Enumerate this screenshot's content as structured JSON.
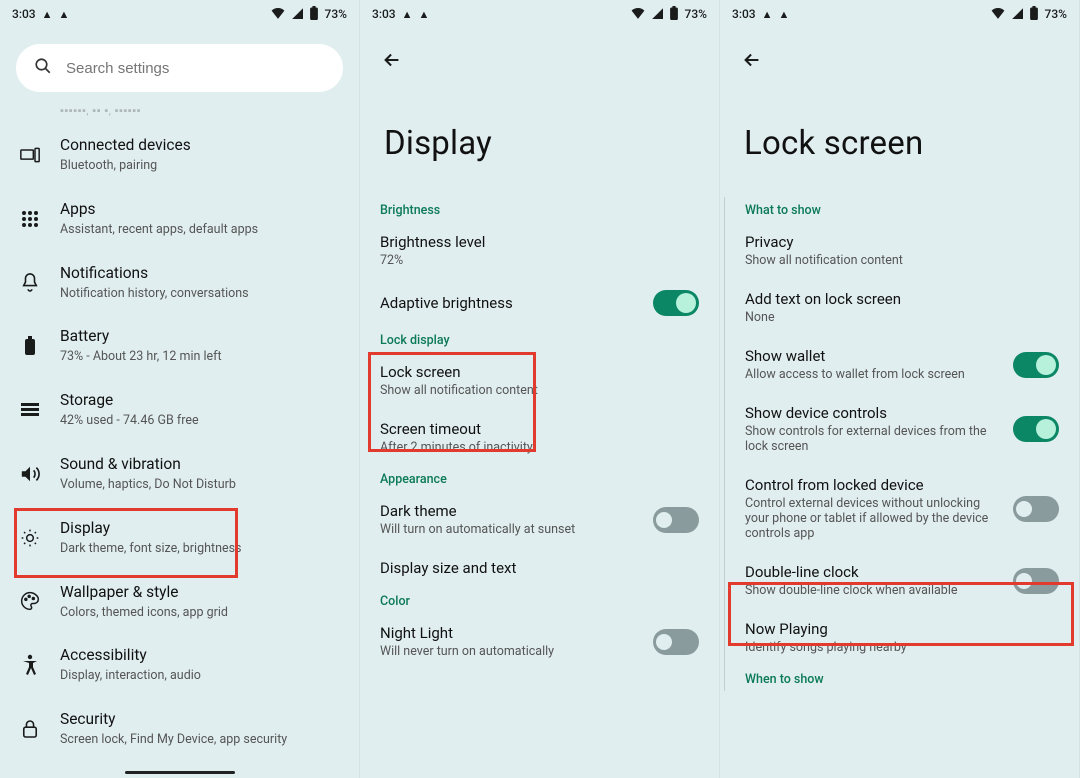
{
  "status": {
    "time": "3:03",
    "battery": "73%"
  },
  "panel1": {
    "search_placeholder": "Search settings",
    "truncated_sub": "Mobile, Wi-Fi, hotspot",
    "items": [
      {
        "title": "Connected devices",
        "sub": "Bluetooth, pairing"
      },
      {
        "title": "Apps",
        "sub": "Assistant, recent apps, default apps"
      },
      {
        "title": "Notifications",
        "sub": "Notification history, conversations"
      },
      {
        "title": "Battery",
        "sub": "73% - About 23 hr, 12 min left"
      },
      {
        "title": "Storage",
        "sub": "42% used - 74.46 GB free"
      },
      {
        "title": "Sound & vibration",
        "sub": "Volume, haptics, Do Not Disturb"
      },
      {
        "title": "Display",
        "sub": "Dark theme, font size, brightness"
      },
      {
        "title": "Wallpaper & style",
        "sub": "Colors, themed icons, app grid"
      },
      {
        "title": "Accessibility",
        "sub": "Display, interaction, audio"
      },
      {
        "title": "Security",
        "sub": "Screen lock, Find My Device, app security"
      }
    ]
  },
  "panel2": {
    "title": "Display",
    "sections": {
      "brightness": "Brightness",
      "lock_display": "Lock display",
      "appearance": "Appearance",
      "color": "Color"
    },
    "brightness_level": {
      "title": "Brightness level",
      "sub": "72%"
    },
    "adaptive": {
      "title": "Adaptive brightness",
      "on": true
    },
    "lock_screen": {
      "title": "Lock screen",
      "sub": "Show all notification content"
    },
    "screen_timeout": {
      "title": "Screen timeout",
      "sub": "After 2 minutes of inactivity"
    },
    "dark_theme": {
      "title": "Dark theme",
      "sub": "Will turn on automatically at sunset",
      "on": false
    },
    "display_size": {
      "title": "Display size and text"
    },
    "night_light": {
      "title": "Night Light",
      "sub": "Will never turn on automatically",
      "on": false
    }
  },
  "panel3": {
    "title": "Lock screen",
    "sections": {
      "what": "What to show",
      "when": "When to show"
    },
    "privacy": {
      "title": "Privacy",
      "sub": "Show all notification content"
    },
    "add_text": {
      "title": "Add text on lock screen",
      "sub": "None"
    },
    "wallet": {
      "title": "Show wallet",
      "sub": "Allow access to wallet from lock screen",
      "on": true
    },
    "device_controls": {
      "title": "Show device controls",
      "sub": "Show controls for external devices from the lock screen",
      "on": true
    },
    "control_locked": {
      "title": "Control from locked device",
      "sub": "Control external devices without unlocking your phone or tablet if allowed by the device controls app",
      "on": false
    },
    "double_line": {
      "title": "Double-line clock",
      "sub": "Show double-line clock when available",
      "on": false
    },
    "now_playing": {
      "title": "Now Playing",
      "sub": "Identify songs playing nearby"
    }
  }
}
